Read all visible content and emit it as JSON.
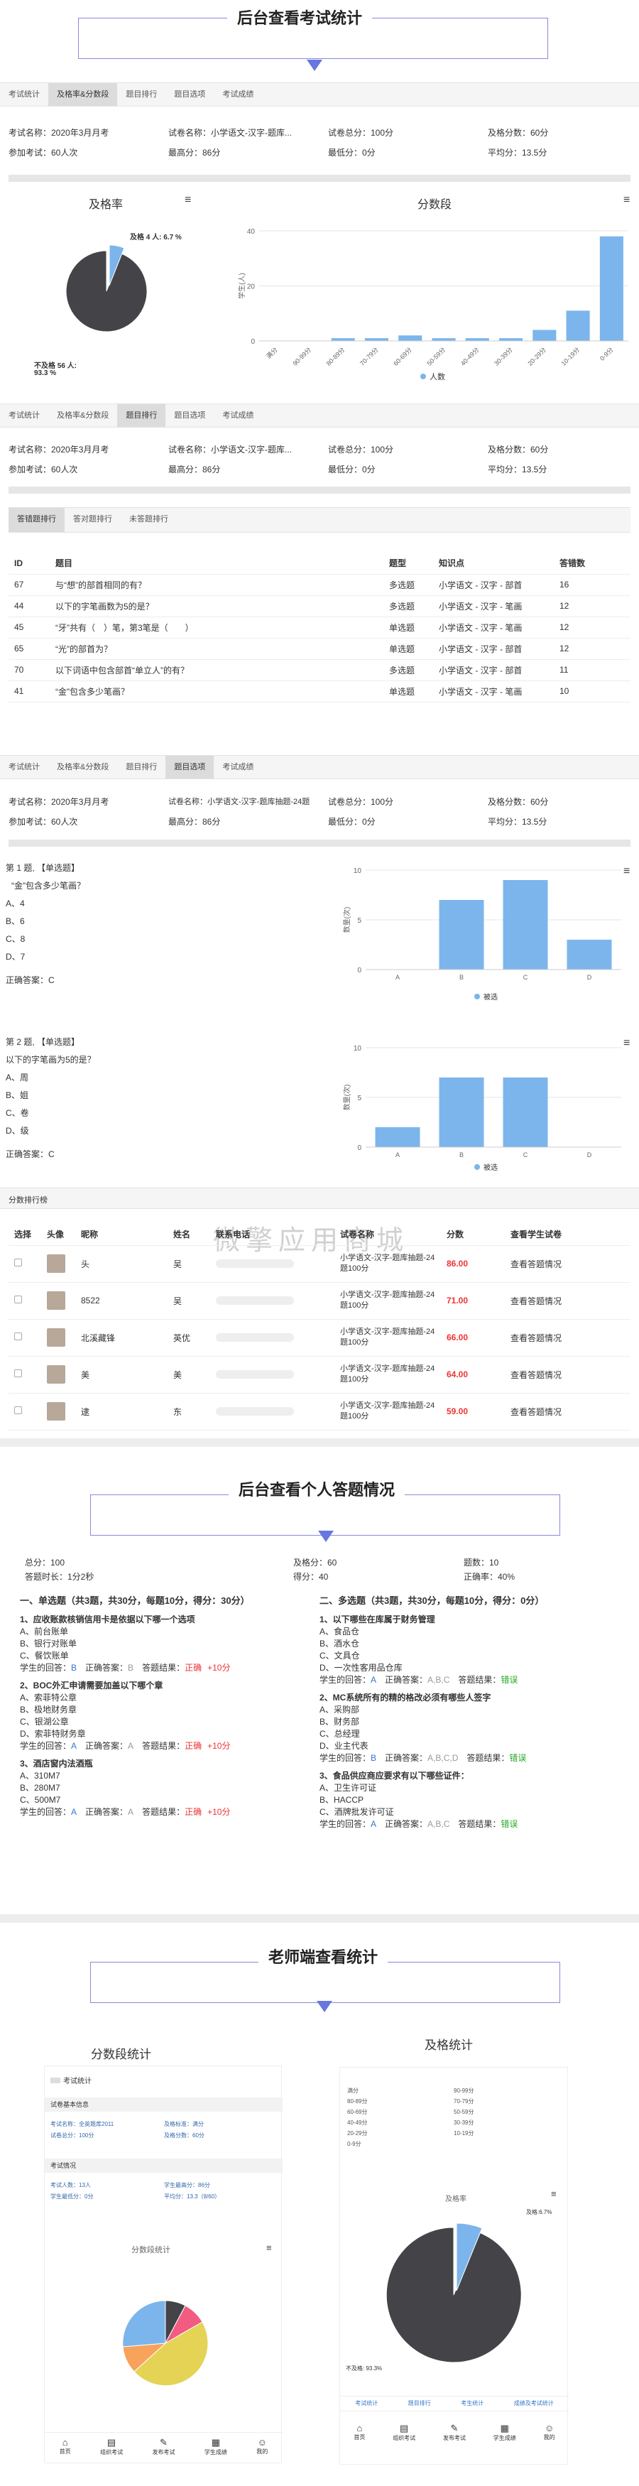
{
  "section1": {
    "title": "后台查看考试统计"
  },
  "tabs": [
    "考试统计",
    "及格率&分数段",
    "题目排行",
    "题目选项",
    "考试成绩"
  ],
  "exam_info": {
    "row1": [
      "考试名称：2020年3月月考",
      "试卷名称：小学语文-汉字-题库...",
      "试卷总分：100分",
      "及格分数：60分"
    ],
    "row2": [
      "参加考试：60人次",
      "最高分：86分",
      "最低分：0分",
      "平均分：13.5分"
    ]
  },
  "exam_info_b": {
    "row1": [
      "考试名称：2020年3月月考",
      "试卷名称：小学语文-汉字-题库...",
      "试卷总分：100分",
      "及格分数：60分"
    ],
    "row2": [
      "参加考试：60人次",
      "最高分：86分",
      "最低分：0分",
      "平均分：13.5分"
    ]
  },
  "exam_info_c": {
    "row1": [
      "考试名称：2020年3月月考",
      "试卷名称：小学语文-汉字-题库抽题-24题",
      "试卷总分：100分",
      "及格分数：60分"
    ],
    "row2": [
      "参加考试：60人次",
      "最高分：86分",
      "最低分：0分",
      "平均分：13.5分"
    ]
  },
  "pass_chart": {
    "title": "及格率",
    "label_pass": "及格 4 人: 6.7 %",
    "label_fail_1": "不及格 56 人:",
    "label_fail_2": "93.3 %"
  },
  "score_chart": {
    "title": "分数段",
    "ylabel": "学生(人)",
    "legend": "人数",
    "yticks": [
      "40",
      "20",
      "0"
    ]
  },
  "rank_subtabs": [
    "答错题排行",
    "答对题排行",
    "未答题排行"
  ],
  "rank_table": {
    "headers": [
      "ID",
      "题目",
      "题型",
      "知识点",
      "答错数"
    ],
    "rows": [
      [
        "67",
        "与“想”的部首相同的有？",
        "多选题",
        "小学语文 - 汉字 - 部首",
        "16"
      ],
      [
        "44",
        "以下的字笔画数为5的是？",
        "多选题",
        "小学语文 - 汉字 - 笔画",
        "12"
      ],
      [
        "45",
        "“牙”共有（　）笔，第3笔是（　　）",
        "单选题",
        "小学语文 - 汉字 - 笔画",
        "12"
      ],
      [
        "65",
        "“光”的部首为？",
        "单选题",
        "小学语文 - 汉字 - 部首",
        "12"
      ],
      [
        "70",
        "以下词语中包含部首“单立人”的有？",
        "多选题",
        "小学语文 - 汉字 - 部首",
        "11"
      ],
      [
        "41",
        "“金”包含多少笔画？",
        "单选题",
        "小学语文 - 汉字 - 笔画",
        "10"
      ]
    ]
  },
  "q1": {
    "title": "第 1 题, 【单选题】",
    "text": "“金”包含多少笔画？",
    "options": [
      "A、4",
      "B、6",
      "C、8",
      "D、7"
    ],
    "answer": "正确答案：C",
    "ylabel": "数量(次)",
    "legend": "被选",
    "yticks": [
      "10",
      "5",
      "0"
    ]
  },
  "q2": {
    "title": "第 2 题, 【单选题】",
    "text": "以下的字笔画为5的是？",
    "options": [
      "A、周",
      "B、姐",
      "C、卷",
      "D、级"
    ],
    "answer": "正确答案：C",
    "ylabel": "数量(次)",
    "legend": "被选",
    "yticks": [
      "10",
      "5",
      "0"
    ]
  },
  "score_rank": {
    "title": "分数排行榜",
    "headers": [
      "选择",
      "头像",
      "昵称",
      "姓名",
      "联系电话",
      "试卷名称",
      "分数",
      "查看学生试卷"
    ],
    "rows": [
      {
        "nick": "头",
        "name": "吴",
        "paper": "小学语文-汉字-题库抽题-24题100分",
        "score": "86.00",
        "action": "查看答题情况"
      },
      {
        "nick": "8522",
        "name": "吴",
        "paper": "小学语文-汉字-题库抽题-24题100分",
        "score": "71.00",
        "action": "查看答题情况"
      },
      {
        "nick": "北溪藏锋",
        "name": "英优",
        "paper": "小学语文-汉字-题库抽题-24题100分",
        "score": "66.00",
        "action": "查看答题情况"
      },
      {
        "nick": "美",
        "name": "美",
        "paper": "小学语文-汉字-题库抽题-24题100分",
        "score": "64.00",
        "action": "查看答题情况"
      },
      {
        "nick": "逮",
        "name": "东",
        "paper": "小学语文-汉字-题库抽题-24题100分",
        "score": "59.00",
        "action": "查看答题情况"
      }
    ]
  },
  "watermark": "微擎应用商城",
  "section2": {
    "title": "后台查看个人答题情况"
  },
  "personal_summary": [
    "总分：100",
    "及格分：60",
    "题数：10",
    "答题时长：1分2秒",
    "得分：40",
    "正确率：40%"
  ],
  "personal_left": {
    "title": "一、单选题（共3题，共30分，每题10分，得分：30分）",
    "items": [
      {
        "q": "1、应收账款核销信用卡是依据以下哪一个选项",
        "opts": [
          "A、前台账单",
          "B、银行对账单",
          "C、餐饮账单"
        ],
        "student": "B",
        "correct": "B",
        "result": "正确",
        "pts": "+10分"
      },
      {
        "q": "2、BOC外汇申请需要加盖以下哪个章",
        "opts": [
          "A、索菲特公章",
          "B、极地财务章",
          "C、银湖公章",
          "D、索菲特财务章"
        ],
        "student": "A",
        "correct": "A",
        "result": "正确",
        "pts": "+10分"
      },
      {
        "q": "3、酒店窗内法酒瓶",
        "opts": [
          "A、310M7",
          "B、280M7",
          "C、500M7"
        ],
        "student": "A",
        "correct": "A",
        "result": "正确",
        "pts": "+10分"
      }
    ],
    "lbl_student": "学生的回答：",
    "lbl_correct": "正确答案：",
    "lbl_result": "答题结果："
  },
  "personal_right": {
    "title": "二、多选题（共3题，共30分，每题10分，得分：0分）",
    "items": [
      {
        "q": "1、以下哪些在库属于财务管理",
        "opts": [
          "A、食品仓",
          "B、酒水仓",
          "C、文具仓",
          "D、一次性客用品仓库"
        ],
        "student": "A",
        "correct": "A,B,C",
        "result": "错误"
      },
      {
        "q": "2、MC系统所有的精的格改必须有哪些人签字",
        "opts": [
          "A、采购部",
          "B、财务部",
          "C、总经理",
          "D、业主代表"
        ],
        "student": "B",
        "correct": "A,B,C,D",
        "result": "错误"
      },
      {
        "q": "3、食品供应商应要求有以下哪些证件：",
        "opts": [
          "A、卫生许可证",
          "B、HACCP",
          "C、酒牌批发许可证"
        ],
        "student": "A",
        "correct": "A,B,C",
        "result": "错误"
      }
    ],
    "lbl_student": "学生的回答：",
    "lbl_correct": "正确答案：",
    "lbl_result": "答题结果："
  },
  "section3": {
    "title": "老师端查看统计"
  },
  "teacher_left": {
    "title": "分数段统计",
    "sub": "考试统计",
    "box1": "试卷基本信息",
    "box2": "考试情况",
    "pie_title": "分数段统计",
    "nav": [
      "首页",
      "组织考试",
      "发布考试",
      "学生成绩",
      "我的"
    ]
  },
  "teacher_right": {
    "title": "及格统计",
    "pie_title": "及格率",
    "pass_label": "及格:6.7%",
    "fail_label": "不及格: 93.3%",
    "tabs": [
      "考试统计",
      "题目排行",
      "考生统计",
      "成绩及考试统计"
    ],
    "nav": [
      "首页",
      "组织考试",
      "发布考试",
      "学生成绩",
      "我的"
    ]
  },
  "score_bins": [
    "满分",
    "90-99分",
    "80-89分",
    "70-79分",
    "60-69分",
    "50-59分",
    "40-49分",
    "30-39分",
    "20-29分",
    "10-19分",
    "0-9分"
  ],
  "chart_data": [
    {
      "type": "pie",
      "title": "及格率",
      "labels": [
        "及格",
        "不及格"
      ],
      "values": [
        4,
        56
      ]
    },
    {
      "type": "bar",
      "title": "分数段",
      "ylabel": "学生(人)",
      "categories": [
        "满分",
        "90-99分",
        "80-89分",
        "70-79分",
        "60-69分",
        "50-59分",
        "40-49分",
        "30-39分",
        "20-29分",
        "10-19分",
        "0-9分"
      ],
      "series": [
        {
          "name": "人数",
          "values": [
            0,
            0,
            1,
            1,
            2,
            1,
            1,
            1,
            4,
            11,
            38
          ]
        }
      ],
      "ylim": [
        0,
        40
      ]
    },
    {
      "type": "bar",
      "title": "第 1 题",
      "ylabel": "数量(次)",
      "categories": [
        "A",
        "B",
        "C",
        "D"
      ],
      "series": [
        {
          "name": "被选",
          "values": [
            0,
            7,
            9,
            3
          ]
        }
      ],
      "ylim": [
        0,
        10
      ]
    },
    {
      "type": "bar",
      "title": "第 2 题",
      "ylabel": "数量(次)",
      "categories": [
        "A",
        "B",
        "C",
        "D"
      ],
      "series": [
        {
          "name": "被选",
          "values": [
            2,
            7,
            7,
            0
          ]
        }
      ],
      "ylim": [
        0,
        10
      ]
    }
  ]
}
